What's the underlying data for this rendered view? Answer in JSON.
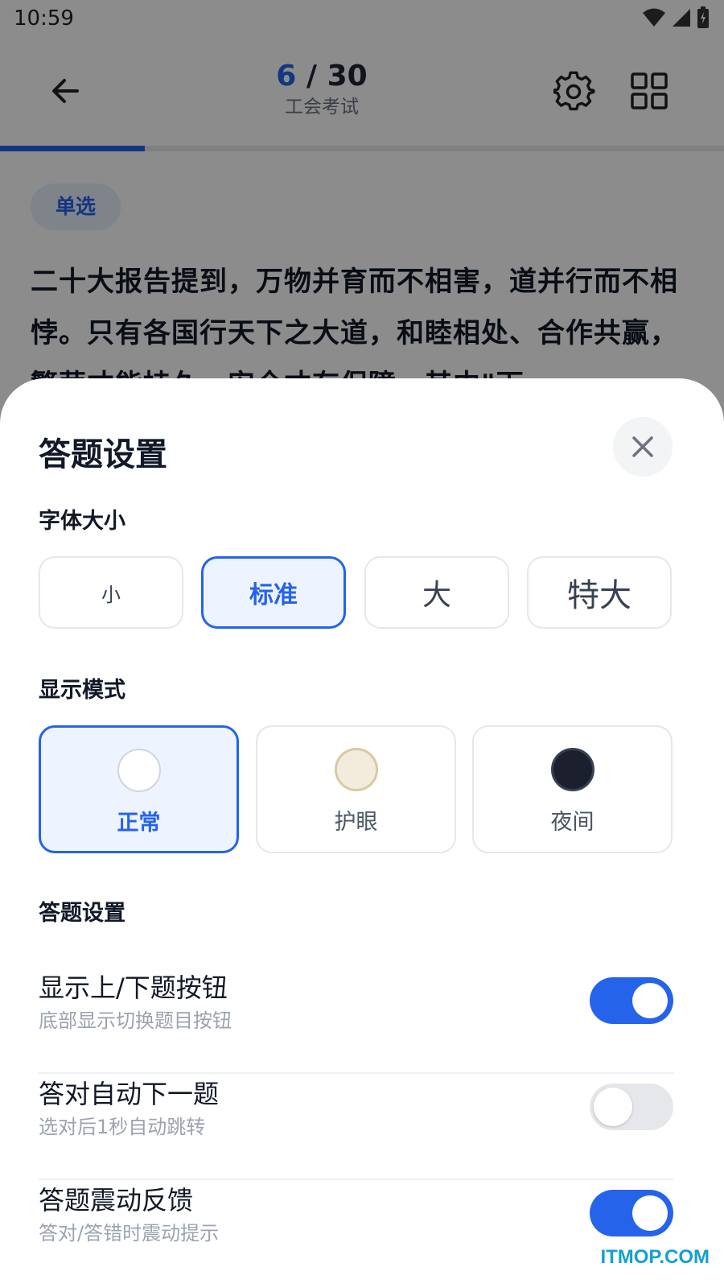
{
  "status_bar": {
    "time": "10:59"
  },
  "header": {
    "current_question": "6",
    "separator": " / ",
    "total_questions": "30",
    "exam_name": "工会考试",
    "progress_fraction": 0.2
  },
  "question": {
    "type_badge": "单选",
    "text": "二十大报告提到，万物并育而不相害，道并行而不相悖。只有各国行天下之大道，和睦相处、合作共赢，繁荣才能持久，安全才有保障。其中\"下"
  },
  "sheet": {
    "title": "答题设置",
    "font_size": {
      "label": "字体大小",
      "options": [
        "小",
        "标准",
        "大",
        "特大"
      ],
      "selected": "标准"
    },
    "display_mode": {
      "label": "显示模式",
      "options": [
        {
          "label": "正常",
          "color": "#ffffff"
        },
        {
          "label": "护眼",
          "color": "#f3ecdc"
        },
        {
          "label": "夜间",
          "color": "#1c1f2e"
        }
      ],
      "selected": "正常"
    },
    "answer_settings": {
      "label": "答题设置",
      "items": [
        {
          "title": "显示上/下题按钮",
          "subtitle": "底部显示切换题目按钮",
          "enabled": true
        },
        {
          "title": "答对自动下一题",
          "subtitle": "选对后1秒自动跳转",
          "enabled": false
        },
        {
          "title": "答题震动反馈",
          "subtitle": "答对/答错时震动提示",
          "enabled": true
        }
      ]
    }
  },
  "colors": {
    "accent": "#2563eb",
    "overlay": "rgba(0,0,0,0.45)"
  },
  "watermark": "ITMOP.COM"
}
